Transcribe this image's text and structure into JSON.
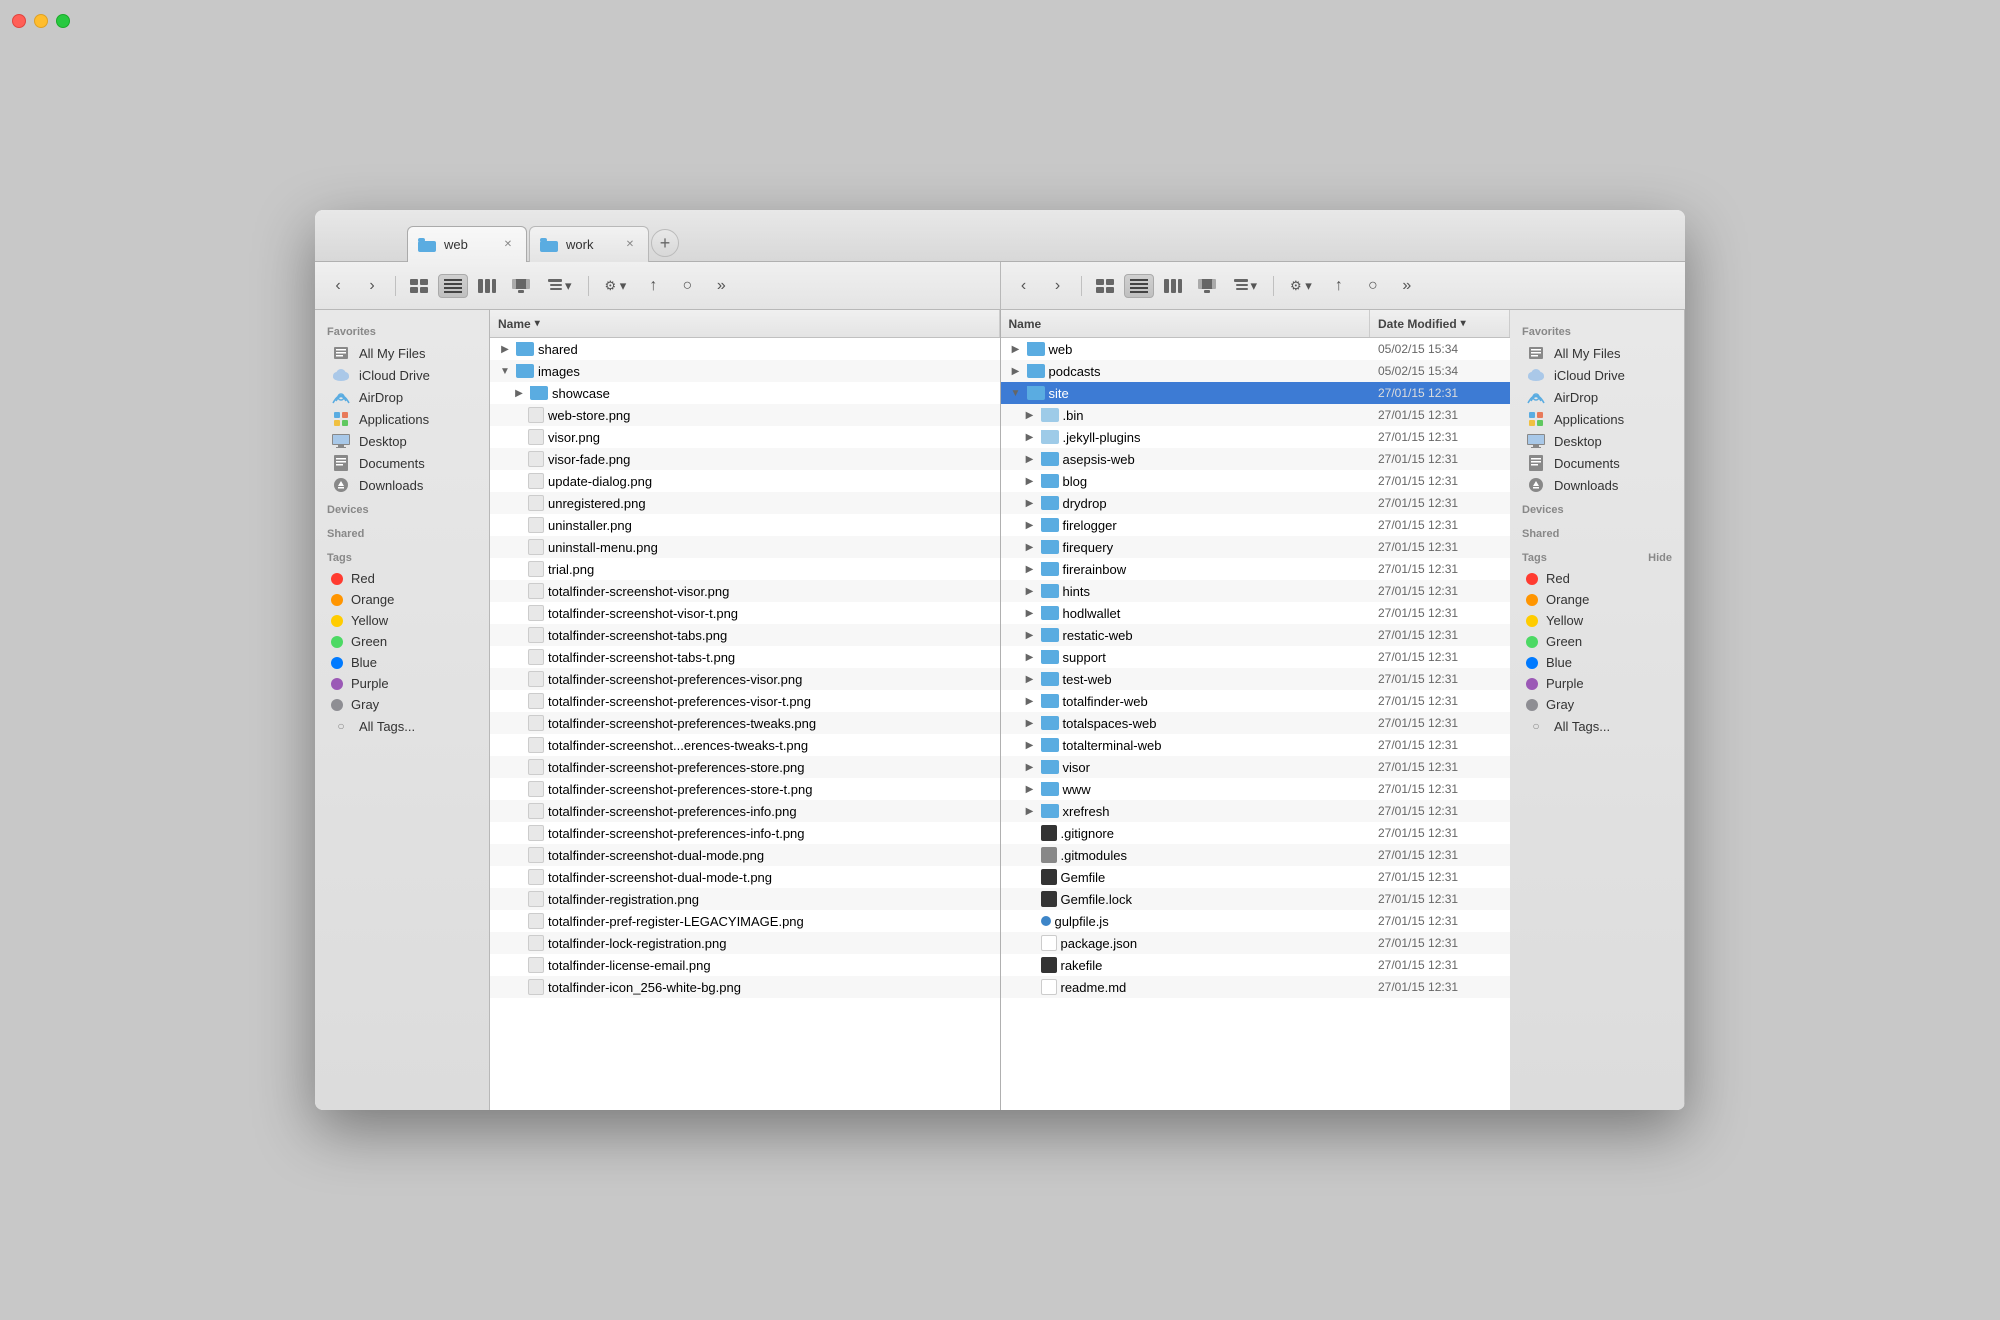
{
  "window": {
    "tabs": [
      {
        "id": "web",
        "label": "web",
        "active": true
      },
      {
        "id": "work",
        "label": "work",
        "active": false
      }
    ]
  },
  "leftPane": {
    "toolbar": {
      "back_label": "◀",
      "forward_label": "▶",
      "view_icons_label": "⊞",
      "view_list_label": "≡",
      "view_columns_label": "▦",
      "view_cover_label": "⊡",
      "view_group_label": "⊟",
      "action_label": "⚙",
      "share_label": "↑",
      "tag_label": "○",
      "more_label": "»"
    },
    "sidebar": {
      "sections": [
        {
          "header": "Favorites",
          "items": [
            {
              "id": "all-my-files",
              "label": "All My Files",
              "icon": "📄"
            },
            {
              "id": "icloud-drive",
              "label": "iCloud Drive",
              "icon": "☁"
            },
            {
              "id": "airdrop",
              "label": "AirDrop",
              "icon": "📡"
            },
            {
              "id": "applications",
              "label": "Applications",
              "icon": "🅰"
            },
            {
              "id": "desktop",
              "label": "Desktop",
              "icon": "🖥"
            },
            {
              "id": "documents",
              "label": "Documents",
              "icon": "📋"
            },
            {
              "id": "downloads",
              "label": "Downloads",
              "icon": "⬇"
            }
          ]
        },
        {
          "header": "Devices",
          "items": []
        },
        {
          "header": "Shared",
          "items": []
        },
        {
          "header": "Tags",
          "items": [
            {
              "id": "tag-red",
              "label": "Red",
              "color": "#ff3b30"
            },
            {
              "id": "tag-orange",
              "label": "Orange",
              "color": "#ff9500"
            },
            {
              "id": "tag-yellow",
              "label": "Yellow",
              "color": "#ffcc00"
            },
            {
              "id": "tag-green",
              "label": "Green",
              "color": "#4cd964"
            },
            {
              "id": "tag-blue",
              "label": "Blue",
              "color": "#007aff"
            },
            {
              "id": "tag-purple",
              "label": "Purple",
              "color": "#9b59b6"
            },
            {
              "id": "tag-gray",
              "label": "Gray",
              "color": "#8e8e93"
            },
            {
              "id": "tag-all",
              "label": "All Tags...",
              "color": null
            }
          ]
        }
      ]
    },
    "fileList": {
      "columns": {
        "name": "Name",
        "date": "Date Modified"
      },
      "items": [
        {
          "id": 1,
          "indent": 0,
          "type": "folder-blue",
          "name": "shared",
          "date": "",
          "disclosure": "▶"
        },
        {
          "id": 2,
          "indent": 0,
          "type": "folder-blue",
          "name": "images",
          "date": "",
          "disclosure": "▼",
          "expanded": true
        },
        {
          "id": 3,
          "indent": 1,
          "type": "folder-blue",
          "name": "showcase",
          "date": "",
          "disclosure": "▶"
        },
        {
          "id": 4,
          "indent": 2,
          "type": "png",
          "name": "web-store.png",
          "date": ""
        },
        {
          "id": 5,
          "indent": 2,
          "type": "png",
          "name": "visor.png",
          "date": ""
        },
        {
          "id": 6,
          "indent": 2,
          "type": "png",
          "name": "visor-fade.png",
          "date": ""
        },
        {
          "id": 7,
          "indent": 2,
          "type": "png",
          "name": "update-dialog.png",
          "date": ""
        },
        {
          "id": 8,
          "indent": 2,
          "type": "png",
          "name": "unregistered.png",
          "date": ""
        },
        {
          "id": 9,
          "indent": 2,
          "type": "png",
          "name": "uninstaller.png",
          "date": ""
        },
        {
          "id": 10,
          "indent": 2,
          "type": "png",
          "name": "uninstall-menu.png",
          "date": ""
        },
        {
          "id": 11,
          "indent": 2,
          "type": "png",
          "name": "trial.png",
          "date": ""
        },
        {
          "id": 12,
          "indent": 2,
          "type": "png",
          "name": "totalfinder-screenshot-visor.png",
          "date": ""
        },
        {
          "id": 13,
          "indent": 2,
          "type": "png",
          "name": "totalfinder-screenshot-visor-t.png",
          "date": ""
        },
        {
          "id": 14,
          "indent": 2,
          "type": "png",
          "name": "totalfinder-screenshot-tabs.png",
          "date": ""
        },
        {
          "id": 15,
          "indent": 2,
          "type": "png",
          "name": "totalfinder-screenshot-tabs-t.png",
          "date": ""
        },
        {
          "id": 16,
          "indent": 2,
          "type": "png",
          "name": "totalfinder-screenshot-preferences-visor.png",
          "date": ""
        },
        {
          "id": 17,
          "indent": 2,
          "type": "png",
          "name": "totalfinder-screenshot-preferences-visor-t.png",
          "date": ""
        },
        {
          "id": 18,
          "indent": 2,
          "type": "png",
          "name": "totalfinder-screenshot-preferences-tweaks.png",
          "date": ""
        },
        {
          "id": 19,
          "indent": 2,
          "type": "png",
          "name": "totalfinder-screenshot...erences-tweaks-t.png",
          "date": ""
        },
        {
          "id": 20,
          "indent": 2,
          "type": "png",
          "name": "totalfinder-screenshot-preferences-store.png",
          "date": ""
        },
        {
          "id": 21,
          "indent": 2,
          "type": "png",
          "name": "totalfinder-screenshot-preferences-store-t.png",
          "date": ""
        },
        {
          "id": 22,
          "indent": 2,
          "type": "png",
          "name": "totalfinder-screenshot-preferences-info.png",
          "date": ""
        },
        {
          "id": 23,
          "indent": 2,
          "type": "png",
          "name": "totalfinder-screenshot-preferences-info-t.png",
          "date": ""
        },
        {
          "id": 24,
          "indent": 2,
          "type": "png",
          "name": "totalfinder-screenshot-dual-mode.png",
          "date": ""
        },
        {
          "id": 25,
          "indent": 2,
          "type": "png",
          "name": "totalfinder-screenshot-dual-mode-t.png",
          "date": ""
        },
        {
          "id": 26,
          "indent": 2,
          "type": "png",
          "name": "totalfinder-registration.png",
          "date": ""
        },
        {
          "id": 27,
          "indent": 2,
          "type": "png",
          "name": "totalfinder-pref-register-LEGACYIMAGE.png",
          "date": ""
        },
        {
          "id": 28,
          "indent": 2,
          "type": "png",
          "name": "totalfinder-lock-registration.png",
          "date": ""
        },
        {
          "id": 29,
          "indent": 2,
          "type": "png",
          "name": "totalfinder-license-email.png",
          "date": ""
        },
        {
          "id": 30,
          "indent": 2,
          "type": "png",
          "name": "totalfinder-icon_256-white-bg.png",
          "date": ""
        }
      ]
    }
  },
  "rightPane": {
    "sidebar": {
      "sections": [
        {
          "header": "Favorites",
          "items": [
            {
              "id": "all-my-files",
              "label": "All My Files",
              "icon": "📄"
            },
            {
              "id": "icloud-drive",
              "label": "iCloud Drive",
              "icon": "☁"
            },
            {
              "id": "airdrop",
              "label": "AirDrop",
              "icon": "📡"
            },
            {
              "id": "applications",
              "label": "Applications",
              "icon": "🅰"
            },
            {
              "id": "desktop",
              "label": "Desktop",
              "icon": "🖥"
            },
            {
              "id": "documents",
              "label": "Documents",
              "icon": "📋"
            },
            {
              "id": "downloads",
              "label": "Downloads",
              "icon": "⬇"
            }
          ]
        },
        {
          "header": "Devices",
          "items": []
        },
        {
          "header": "Shared",
          "items": []
        },
        {
          "header": "Tags",
          "items": [
            {
              "id": "tag-red",
              "label": "Red",
              "color": "#ff3b30"
            },
            {
              "id": "tag-orange",
              "label": "Orange",
              "color": "#ff9500"
            },
            {
              "id": "tag-yellow",
              "label": "Yellow",
              "color": "#ffcc00"
            },
            {
              "id": "tag-green",
              "label": "Green",
              "color": "#4cd964"
            },
            {
              "id": "tag-blue",
              "label": "Blue",
              "color": "#007aff"
            },
            {
              "id": "tag-purple",
              "label": "Purple",
              "color": "#9b59b6"
            },
            {
              "id": "tag-gray",
              "label": "Gray",
              "color": "#8e8e93"
            },
            {
              "id": "tag-all",
              "label": "All Tags...",
              "color": null
            },
            {
              "id": "tag-hide",
              "label": "Hide",
              "color": null
            }
          ]
        }
      ]
    },
    "fileList": {
      "columns": {
        "name": "Name",
        "date": "Date Modified"
      },
      "items": [
        {
          "id": 1,
          "indent": 0,
          "type": "folder-blue",
          "name": "web",
          "date": "05/02/15 15:34",
          "disclosure": "▶"
        },
        {
          "id": 2,
          "indent": 0,
          "type": "folder-blue",
          "name": "podcasts",
          "date": "05/02/15 15:34",
          "disclosure": "▶"
        },
        {
          "id": 3,
          "indent": 0,
          "type": "folder-blue",
          "name": "site",
          "date": "27/01/15 12:31",
          "disclosure": "▼",
          "expanded": true,
          "selected": true
        },
        {
          "id": 4,
          "indent": 1,
          "type": "folder-light",
          "name": ".bin",
          "date": "27/01/15 12:31",
          "disclosure": "▶"
        },
        {
          "id": 5,
          "indent": 1,
          "type": "folder-light",
          "name": ".jekyll-plugins",
          "date": "27/01/15 12:31",
          "disclosure": "▶"
        },
        {
          "id": 6,
          "indent": 1,
          "type": "folder-blue",
          "name": "asepsis-web",
          "date": "27/01/15 12:31",
          "disclosure": "▶"
        },
        {
          "id": 7,
          "indent": 1,
          "type": "folder-blue",
          "name": "blog",
          "date": "27/01/15 12:31",
          "disclosure": "▶"
        },
        {
          "id": 8,
          "indent": 1,
          "type": "folder-blue",
          "name": "drydrop",
          "date": "27/01/15 12:31",
          "disclosure": "▶"
        },
        {
          "id": 9,
          "indent": 1,
          "type": "folder-blue",
          "name": "firelogger",
          "date": "27/01/15 12:31",
          "disclosure": "▶"
        },
        {
          "id": 10,
          "indent": 1,
          "type": "folder-blue",
          "name": "firequery",
          "date": "27/01/15 12:31",
          "disclosure": "▶"
        },
        {
          "id": 11,
          "indent": 1,
          "type": "folder-blue",
          "name": "firerainbow",
          "date": "27/01/15 12:31",
          "disclosure": "▶"
        },
        {
          "id": 12,
          "indent": 1,
          "type": "folder-blue",
          "name": "hints",
          "date": "27/01/15 12:31",
          "disclosure": "▶"
        },
        {
          "id": 13,
          "indent": 1,
          "type": "folder-blue",
          "name": "hodlwallet",
          "date": "27/01/15 12:31",
          "disclosure": "▶"
        },
        {
          "id": 14,
          "indent": 1,
          "type": "folder-blue",
          "name": "restatic-web",
          "date": "27/01/15 12:31",
          "disclosure": "▶"
        },
        {
          "id": 15,
          "indent": 1,
          "type": "folder-blue",
          "name": "support",
          "date": "27/01/15 12:31",
          "disclosure": "▶"
        },
        {
          "id": 16,
          "indent": 1,
          "type": "folder-blue",
          "name": "test-web",
          "date": "27/01/15 12:31",
          "disclosure": "▶"
        },
        {
          "id": 17,
          "indent": 1,
          "type": "folder-blue",
          "name": "totalfinder-web",
          "date": "27/01/15 12:31",
          "disclosure": "▶"
        },
        {
          "id": 18,
          "indent": 1,
          "type": "folder-blue",
          "name": "totalspaces-web",
          "date": "27/01/15 12:31",
          "disclosure": "▶"
        },
        {
          "id": 19,
          "indent": 1,
          "type": "folder-blue",
          "name": "totalterminal-web",
          "date": "27/01/15 12:31",
          "disclosure": "▶"
        },
        {
          "id": 20,
          "indent": 1,
          "type": "folder-blue",
          "name": "visor",
          "date": "27/01/15 12:31",
          "disclosure": "▶"
        },
        {
          "id": 21,
          "indent": 1,
          "type": "folder-blue",
          "name": "www",
          "date": "27/01/15 12:31",
          "disclosure": "▶"
        },
        {
          "id": 22,
          "indent": 1,
          "type": "folder-blue",
          "name": "xrefresh",
          "date": "27/01/15 12:31",
          "disclosure": "▶"
        },
        {
          "id": 23,
          "indent": 1,
          "type": "file-dark",
          "name": ".gitignore",
          "date": "27/01/15 12:31"
        },
        {
          "id": 24,
          "indent": 1,
          "type": "file-gray",
          "name": ".gitmodules",
          "date": "27/01/15 12:31"
        },
        {
          "id": 25,
          "indent": 1,
          "type": "file-dark",
          "name": "Gemfile",
          "date": "27/01/15 12:31"
        },
        {
          "id": 26,
          "indent": 1,
          "type": "file-dark",
          "name": "Gemfile.lock",
          "date": "27/01/15 12:31"
        },
        {
          "id": 27,
          "indent": 1,
          "type": "file-blue-dot",
          "name": "gulpfile.js",
          "date": "27/01/15 12:31"
        },
        {
          "id": 28,
          "indent": 1,
          "type": "file-white",
          "name": "package.json",
          "date": "27/01/15 12:31"
        },
        {
          "id": 29,
          "indent": 1,
          "type": "file-dark",
          "name": "rakefile",
          "date": "27/01/15 12:31"
        },
        {
          "id": 30,
          "indent": 1,
          "type": "file-white",
          "name": "readme.md",
          "date": "27/01/15 12:31"
        }
      ]
    }
  }
}
